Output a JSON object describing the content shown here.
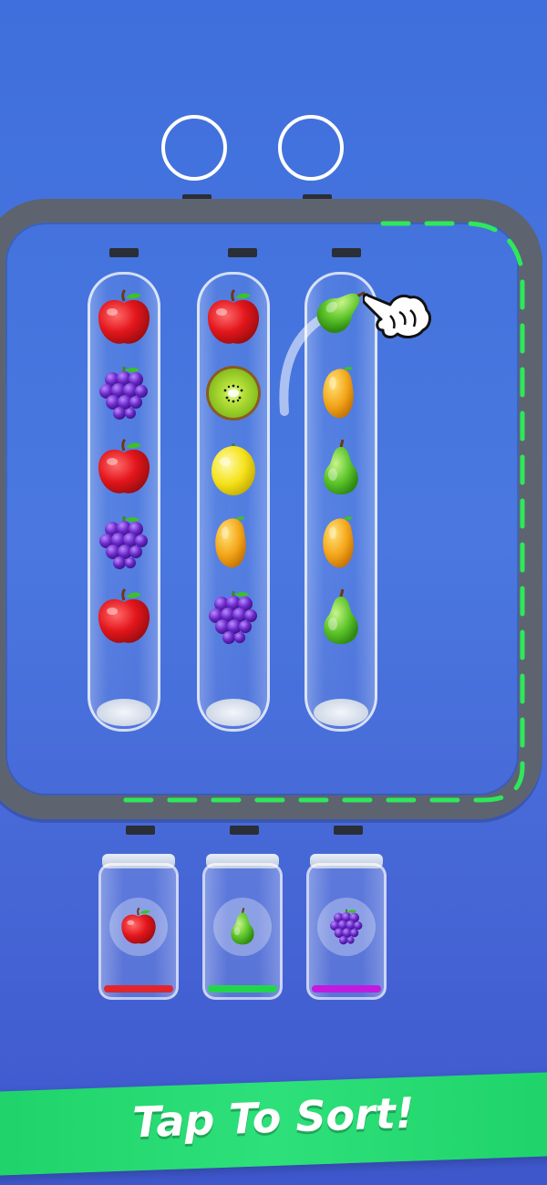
{
  "top_slots": [
    {
      "id": "slot-1"
    },
    {
      "id": "slot-2"
    }
  ],
  "conveyor": {
    "dash_color": "#2ee85a",
    "rail_color": "#5d6470"
  },
  "tubes": [
    {
      "fruits": [
        "apple",
        "grapes",
        "apple",
        "grapes",
        "apple"
      ]
    },
    {
      "fruits": [
        "apple",
        "kiwi",
        "lemon",
        "mango",
        "grapes"
      ]
    },
    {
      "fruits": [
        "pear",
        "mango",
        "pear",
        "mango",
        "pear"
      ]
    }
  ],
  "moving_fruit": "pear",
  "hand_icon": "pointing-hand-icon",
  "jars": [
    {
      "fruit": "apple",
      "fill_color": "#e0262d"
    },
    {
      "fruit": "pear",
      "fill_color": "#22d64c"
    },
    {
      "fruit": "grapes",
      "fill_color": "#c21be0"
    }
  ],
  "banner": {
    "text": "Tap To Sort!",
    "color": "#2ee07a"
  }
}
